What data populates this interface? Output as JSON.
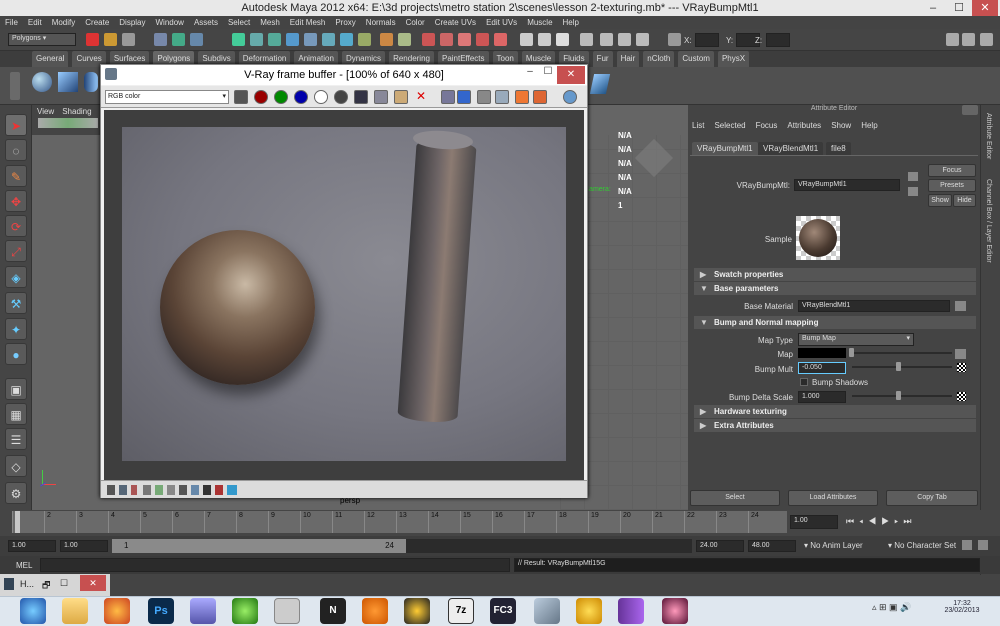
{
  "window": {
    "title": "Autodesk Maya 2012 x64: E:\\3d projects\\metro station 2\\scenes\\lesson 2-texturing.mb*   ---   VRayBumpMtl1"
  },
  "menu": [
    "File",
    "Edit",
    "Modify",
    "Create",
    "Display",
    "Window",
    "Assets",
    "Select",
    "Mesh",
    "Edit Mesh",
    "Proxy",
    "Normals",
    "Color",
    "Create UVs",
    "Edit UVs",
    "Muscle",
    "Help"
  ],
  "status": {
    "mode": "Polygons",
    "x_label": "X:",
    "y_label": "Y:",
    "z_label": "Z:"
  },
  "shelf_tabs": [
    "General",
    "Curves",
    "Surfaces",
    "Polygons",
    "Subdivs",
    "Deformation",
    "Animation",
    "Dynamics",
    "Rendering",
    "PaintEffects",
    "Toon",
    "Muscle",
    "Fluids",
    "Fur",
    "Hair",
    "nCloth",
    "Custom",
    "PhysX"
  ],
  "viewport": {
    "menu": [
      "View",
      "Shading"
    ],
    "hud": [
      "N/A",
      "N/A",
      "N/A",
      "N/A",
      "N/A",
      "1"
    ],
    "camera_label": "Camera:",
    "bottom_label": "persp"
  },
  "vray": {
    "title": "V-Ray frame buffer - [100% of 640 x 480]",
    "channel": "RGB color",
    "buttons": [
      "red-channel",
      "green-channel",
      "blue-channel",
      "white",
      "save",
      "clear",
      "open",
      "close"
    ]
  },
  "attr": {
    "header": "Attribute Editor",
    "menu": [
      "List",
      "Selected",
      "Focus",
      "Attributes",
      "Show",
      "Help"
    ],
    "tabs": [
      "VRayBumpMtl1",
      "VRayBlendMtl1",
      "file8"
    ],
    "node_label": "VRayBumpMtl:",
    "node_value": "VRayBumpMtl1",
    "focus": "Focus",
    "presets": "Presets",
    "show": "Show",
    "hide": "Hide",
    "sample_label": "Sample",
    "sections": {
      "swatch": "Swatch properties",
      "base": "Base parameters",
      "bump": "Bump and Normal mapping",
      "hardware": "Hardware texturing",
      "extra": "Extra Attributes"
    },
    "base_material_label": "Base Material",
    "base_material_value": "VRayBlendMtl1",
    "map_type_label": "Map Type",
    "map_type_value": "Bump Map",
    "map_label": "Map",
    "bump_mult_label": "Bump Mult",
    "bump_mult_value": "-0.050",
    "bump_shadows_label": "Bump Shadows",
    "bump_delta_label": "Bump Delta Scale",
    "bump_delta_value": "1.000",
    "select_btn": "Select",
    "load_btn": "Load Attributes",
    "copy_btn": "Copy Tab"
  },
  "sidebar": [
    "Attribute Editor",
    "Channel Box / Layer Editor"
  ],
  "timeline": {
    "ticks": [
      "1",
      "2",
      "3",
      "4",
      "5",
      "6",
      "7",
      "8",
      "9",
      "10",
      "11",
      "12",
      "13",
      "14",
      "15",
      "16",
      "17",
      "18",
      "19",
      "20",
      "21",
      "22",
      "23",
      "24"
    ],
    "current": "1.00"
  },
  "range": {
    "start": "1.00",
    "start2": "1.00",
    "slider_start": "1",
    "slider_end": "24",
    "end": "24.00",
    "end2": "48.00",
    "anim_layer": "No Anim Layer",
    "char_set": "No Character Set"
  },
  "cmd": {
    "label": "MEL",
    "result": "// Result: VRayBumpMtl15G"
  },
  "taskbar": {
    "time": "17:32",
    "date": "23/02/2013",
    "minimized": "H..."
  }
}
